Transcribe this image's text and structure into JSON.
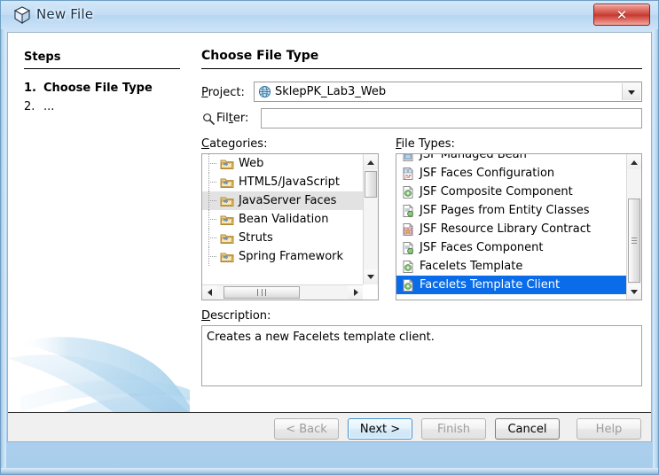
{
  "window": {
    "title": "New File",
    "title_icon": "cube-icon",
    "close_label": "✕",
    "close_icon": "close-icon"
  },
  "steps": {
    "heading": "Steps",
    "items": [
      {
        "number": "1.",
        "label": "Choose File Type",
        "current": true
      },
      {
        "number": "2.",
        "label": "...",
        "current": false
      }
    ]
  },
  "content": {
    "title": "Choose File Type",
    "project": {
      "label_pre": "P",
      "label_post": "roject:",
      "value": "SklepPK_Lab3_Web",
      "icon": "globe-icon",
      "dropdown_icon": "chevron-down-icon"
    },
    "filter": {
      "label_pre": "Fil",
      "label_mn": "t",
      "label_post": "er:",
      "value": "",
      "placeholder": "",
      "icon": "search-icon"
    },
    "categories": {
      "label_pre": "C",
      "label_post": "ategories:",
      "items": [
        {
          "label": "Web",
          "selected": false
        },
        {
          "label": "HTML5/JavaScript",
          "selected": false
        },
        {
          "label": "JavaServer Faces",
          "selected": true
        },
        {
          "label": "Bean Validation",
          "selected": false
        },
        {
          "label": "Struts",
          "selected": false
        },
        {
          "label": "Spring Framework",
          "selected": false
        }
      ]
    },
    "file_types": {
      "label_pre": "F",
      "label_post": "ile Types:",
      "items": [
        {
          "label": "JSF Managed Bean",
          "selected": false,
          "icon": "jsf-bean-icon"
        },
        {
          "label": "JSF Faces Configuration",
          "selected": false,
          "icon": "jsf-config-icon"
        },
        {
          "label": "JSF Composite Component",
          "selected": false,
          "icon": "jsf-composite-icon"
        },
        {
          "label": "JSF Pages from Entity Classes",
          "selected": false,
          "icon": "jsf-pages-icon"
        },
        {
          "label": "JSF Resource Library Contract",
          "selected": false,
          "icon": "jsf-contract-icon"
        },
        {
          "label": "JSF Faces Component",
          "selected": false,
          "icon": "jsf-component-icon"
        },
        {
          "label": "Facelets Template",
          "selected": false,
          "icon": "facelets-template-icon"
        },
        {
          "label": "Facelets Template Client",
          "selected": true,
          "icon": "facelets-client-icon"
        }
      ]
    },
    "description": {
      "label_pre": "D",
      "label_post": "escription:",
      "text": "Creates a new Facelets template client."
    }
  },
  "buttons": {
    "back": "< Back",
    "next": "Next >",
    "finish": "Finish",
    "cancel": "Cancel",
    "help": "Help"
  },
  "colors": {
    "selection_blue": "#0a6ce8",
    "selection_gray": "#e2e2e2",
    "close_red": "#c23a32",
    "titlebar_blue": "#bcd9f2"
  }
}
